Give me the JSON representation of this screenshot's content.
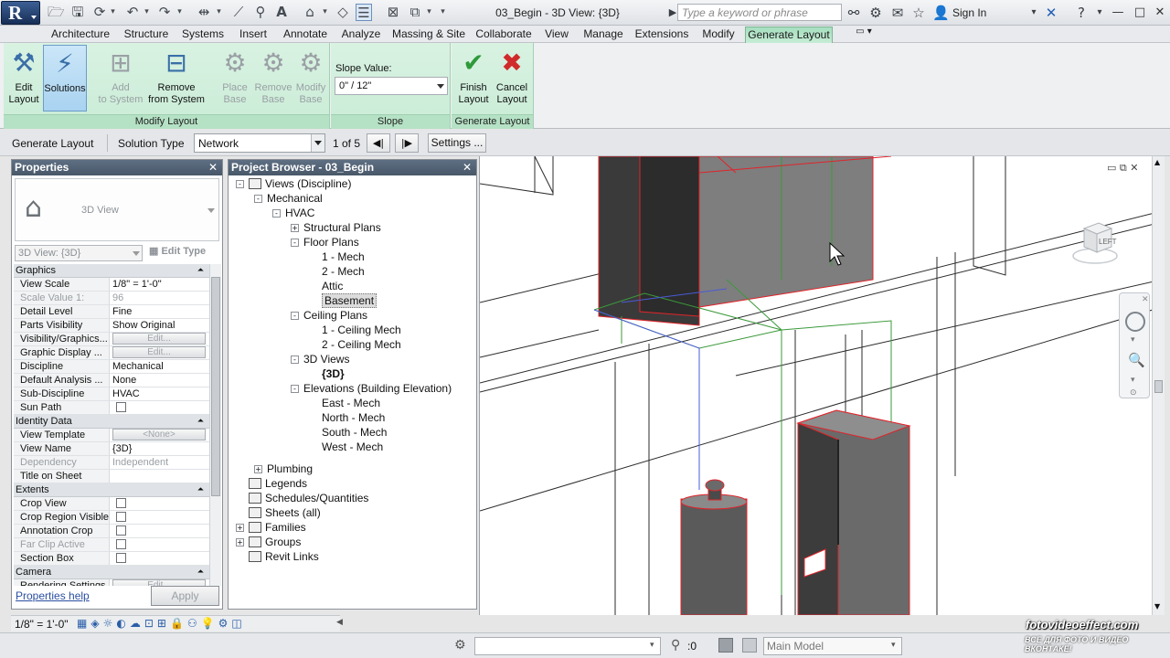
{
  "app": {
    "logo_letter": "R",
    "title": "03_Begin - 3D View: {3D}",
    "search_placeholder": "Type a keyword or phrase",
    "sign_in": "Sign In"
  },
  "tabs": [
    "Architecture",
    "Structure",
    "Systems",
    "Insert",
    "Annotate",
    "Analyze",
    "Massing & Site",
    "Collaborate",
    "View",
    "Manage",
    "Extensions",
    "Modify",
    "Generate Layout"
  ],
  "active_tab": "Generate Layout",
  "ribbon": {
    "modify_layout": {
      "title": "Modify Layout",
      "buttons": [
        {
          "label1": "Edit",
          "label2": "Layout",
          "icon": "edit-layout-icon"
        },
        {
          "label1": "Solutions",
          "label2": "",
          "icon": "solutions-icon"
        },
        {
          "label1": "Add",
          "label2": "to System",
          "icon": "add-to-system-icon"
        },
        {
          "label1": "Remove",
          "label2": "from System",
          "icon": "remove-from-system-icon"
        },
        {
          "label1": "Place",
          "label2": "Base",
          "icon": "place-base-icon"
        },
        {
          "label1": "Remove",
          "label2": "Base",
          "icon": "remove-base-icon"
        },
        {
          "label1": "Modify",
          "label2": "Base",
          "icon": "modify-base-icon"
        }
      ]
    },
    "slope": {
      "title": "Slope",
      "label": "Slope Value:",
      "value": "0\" / 12\""
    },
    "generate_layout": {
      "title": "Generate Layout",
      "finish_label1": "Finish",
      "finish_label2": "Layout",
      "cancel_label1": "Cancel",
      "cancel_label2": "Layout"
    }
  },
  "options_bar": {
    "generate_layout": "Generate Layout",
    "solution_type_label": "Solution Type",
    "solution_type": "Network",
    "count": "1 of 5",
    "settings": "Settings ..."
  },
  "properties": {
    "title": "Properties",
    "type_name": "3D View",
    "instance": "3D View: {3D}",
    "edit_type": "Edit Type",
    "help": "Properties help",
    "apply": "Apply",
    "groups": [
      {
        "name": "Graphics",
        "rows": [
          {
            "k": "View Scale",
            "v": "1/8\" = 1'-0\""
          },
          {
            "k": "Scale Value    1:",
            "v": "96",
            "dis": true
          },
          {
            "k": "Detail Level",
            "v": "Fine"
          },
          {
            "k": "Parts Visibility",
            "v": "Show Original"
          },
          {
            "k": "Visibility/Graphics...",
            "v": "Edit...",
            "btn": true
          },
          {
            "k": "Graphic Display ...",
            "v": "Edit...",
            "btn": true
          },
          {
            "k": "Discipline",
            "v": "Mechanical"
          },
          {
            "k": "Default Analysis ...",
            "v": "None"
          },
          {
            "k": "Sub-Discipline",
            "v": "HVAC"
          },
          {
            "k": "Sun Path",
            "v": "",
            "chk": true
          }
        ]
      },
      {
        "name": "Identity Data",
        "rows": [
          {
            "k": "View Template",
            "v": "<None>",
            "btn": true
          },
          {
            "k": "View Name",
            "v": "{3D}"
          },
          {
            "k": "Dependency",
            "v": "Independent",
            "dis": true
          },
          {
            "k": "Title on Sheet",
            "v": ""
          }
        ]
      },
      {
        "name": "Extents",
        "rows": [
          {
            "k": "Crop View",
            "v": "",
            "chk": true
          },
          {
            "k": "Crop Region Visible",
            "v": "",
            "chk": true
          },
          {
            "k": "Annotation Crop",
            "v": "",
            "chk": true
          },
          {
            "k": "Far Clip Active",
            "v": "",
            "chk": true,
            "dis": true
          },
          {
            "k": "Section Box",
            "v": "",
            "chk": true
          }
        ]
      },
      {
        "name": "Camera",
        "rows": [
          {
            "k": "Rendering Settings",
            "v": "Edit...",
            "btn": true
          }
        ]
      }
    ]
  },
  "browser": {
    "title": "Project Browser - 03_Begin",
    "items": [
      {
        "t": "Views (Discipline)",
        "lvl": 0,
        "ex": "-",
        "ico": "views-icon"
      },
      {
        "t": "Mechanical",
        "lvl": 1,
        "ex": "-"
      },
      {
        "t": "HVAC",
        "lvl": 2,
        "ex": "-"
      },
      {
        "t": "Structural Plans",
        "lvl": 3,
        "ex": "+"
      },
      {
        "t": "Floor Plans",
        "lvl": 3,
        "ex": "-"
      },
      {
        "t": "1 - Mech",
        "lvl": 4
      },
      {
        "t": "2 - Mech",
        "lvl": 4
      },
      {
        "t": "Attic",
        "lvl": 4
      },
      {
        "t": "Basement",
        "lvl": 4,
        "sel": true
      },
      {
        "t": "Ceiling Plans",
        "lvl": 3,
        "ex": "-"
      },
      {
        "t": "1 - Ceiling Mech",
        "lvl": 4
      },
      {
        "t": "2 - Ceiling Mech",
        "lvl": 4
      },
      {
        "t": "3D Views",
        "lvl": 3,
        "ex": "-"
      },
      {
        "t": "{3D}",
        "lvl": 4,
        "bold": true
      },
      {
        "t": "Elevations (Building Elevation)",
        "lvl": 3,
        "ex": "-"
      },
      {
        "t": "East - Mech",
        "lvl": 4
      },
      {
        "t": "North - Mech",
        "lvl": 4
      },
      {
        "t": "South - Mech",
        "lvl": 4
      },
      {
        "t": "West - Mech",
        "lvl": 4
      },
      {
        "t": "Plumbing",
        "lvl": 1,
        "ex": "+",
        "gap": true
      },
      {
        "t": "Legends",
        "lvl": 0,
        "ico": "legends-icon"
      },
      {
        "t": "Schedules/Quantities",
        "lvl": 0,
        "ico": "schedules-icon"
      },
      {
        "t": "Sheets (all)",
        "lvl": 0,
        "ico": "sheets-icon"
      },
      {
        "t": "Families",
        "lvl": 0,
        "ex": "+",
        "ico": "families-icon"
      },
      {
        "t": "Groups",
        "lvl": 0,
        "ex": "+",
        "ico": "groups-icon"
      },
      {
        "t": "Revit Links",
        "lvl": 0,
        "ico": "links-icon"
      }
    ]
  },
  "viewcube_face": "LEFT",
  "view_status": {
    "scale": "1/8\" = 1'-0\""
  },
  "status_bar": {
    "selection_count": ":0",
    "model": "Main Model"
  },
  "watermark": {
    "line1": "fotovideoeffect.com",
    "line2": "ВСЕ ДЛЯ ФОТО И ВИДЕО ВКОНТАКЕ!"
  },
  "colors": {
    "ribbon_green": "#c9ecd6",
    "panel_header": "#485869",
    "highlight_red": "#e0242a"
  }
}
